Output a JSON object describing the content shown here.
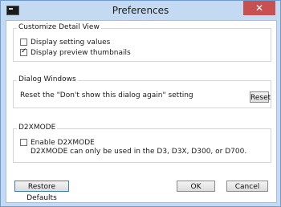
{
  "window": {
    "title": "Preferences",
    "close_glyph": "✕",
    "app_icon": "camera-app-icon"
  },
  "detail_view": {
    "legend": "Customize Detail View",
    "items": [
      {
        "label": "Display setting values",
        "checked": false
      },
      {
        "label": "Display preview thumbnails",
        "checked": true
      }
    ]
  },
  "dialog_windows": {
    "legend": "Dialog Windows",
    "text": "Reset the \"Don't show this dialog again\" setting",
    "reset_label": "Reset"
  },
  "d2xmode": {
    "legend": "D2XMODE",
    "enable_label": "Enable D2XMODE",
    "enable_checked": false,
    "note": "D2XMODE can only be used in the D3, D3X, D300, or D700."
  },
  "footer": {
    "restore_label": "Restore Defaults",
    "ok_label": "OK",
    "cancel_label": "Cancel"
  }
}
